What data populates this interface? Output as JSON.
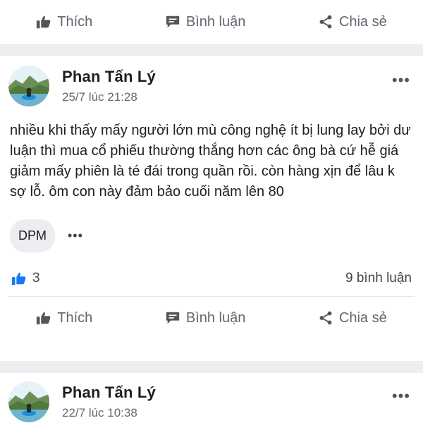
{
  "top_actions": {
    "like": "Thích",
    "comment": "Bình luận",
    "share": "Chia sẻ"
  },
  "post1": {
    "author": "Phan Tấn Lý",
    "time": "25/7 lúc 21:28",
    "more": "•••",
    "text": "nhiều khi thấy mấy người lớn mù công nghệ ít bị lung lay bởi dư luận thì mua cổ phiếu thường thắng hơn các ông bà cứ hễ giá giảm mấy phiên là té đái trong quần rồi. còn hàng xịn để lâu k sợ lỗ. ôm con này đảm bảo cuối năm lên 80",
    "tag": "DPM",
    "tag_more": "•••",
    "likes": "3",
    "comments": "9 bình luận",
    "actions": {
      "like": "Thích",
      "comment": "Bình luận",
      "share": "Chia sẻ"
    }
  },
  "post2": {
    "author": "Phan Tấn Lý",
    "time": "22/7 lúc 10:38",
    "more": "•••"
  },
  "colors": {
    "like_blue": "#1877f2",
    "meta_gray": "#65676b",
    "separator": "#eceef1"
  },
  "icons": {
    "like": "thumbs-up-icon",
    "comment": "comment-bubble-icon",
    "share": "share-icon",
    "more": "more-dots-icon"
  }
}
